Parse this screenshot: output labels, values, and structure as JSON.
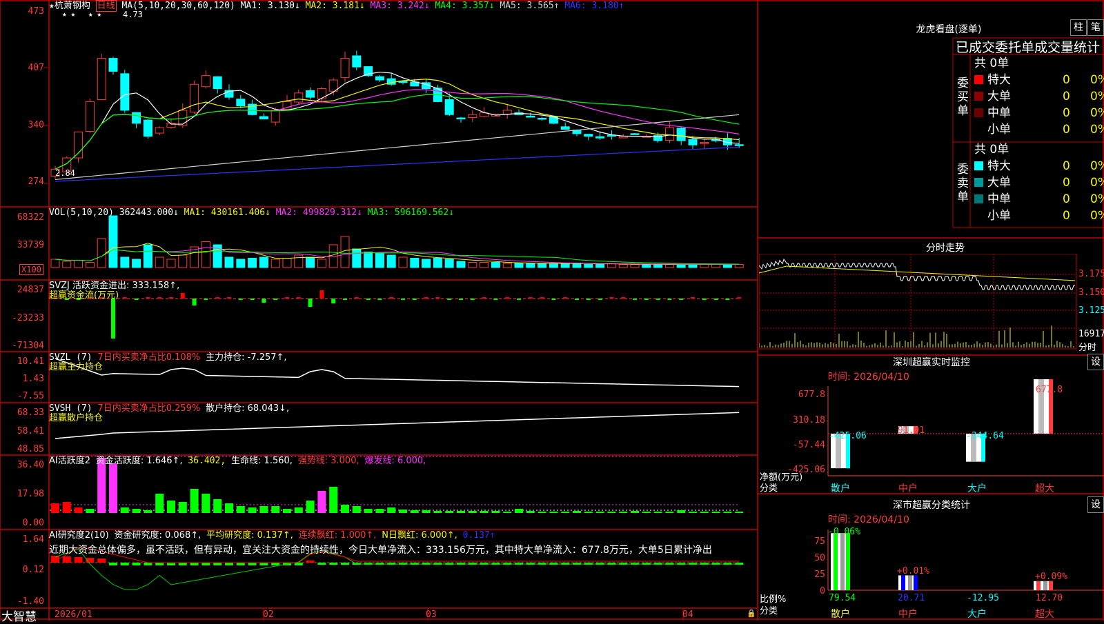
{
  "stock_name": "杭萧钢构",
  "period": "日线",
  "brand": "大智慧",
  "colors": {
    "up": "#ff3b3b",
    "down": "#00ffff",
    "grid": "#c00000",
    "ma1": "#ffffff",
    "ma2": "#f5f500",
    "ma3": "#ff33ff",
    "ma4": "#00ff00",
    "ma5": "#d0d0d0",
    "ma6": "#3030ff"
  },
  "main": {
    "ma_prefix": "MA(5,10,20,30,60,120)",
    "ma1": "MA1: 3.130↓",
    "ma2": "MA2: 3.181↓",
    "ma3": "MA3: 3.242↓",
    "ma4": "MA4: 3.357↓",
    "ma5": "MA5: 3.565↑",
    "ma6": "MA6: 3.180↑",
    "high_label": "4.73",
    "low_label": "2.84",
    "y_labels": [
      "473",
      "407",
      "340",
      "274"
    ]
  },
  "vol": {
    "title": "VOL(5,10,20)",
    "v": "362443.000↓",
    "ma1": "MA1: 430161.406↓",
    "ma2": "MA2: 499829.312↓",
    "ma3": "MA3: 596169.562↓",
    "y_labels": [
      "68322",
      "33739"
    ],
    "unit": "X100"
  },
  "svzj": {
    "title": "SVZJ  活跃资金进出: 333.158↑,",
    "sub": "超赢资金流(万元)",
    "y_labels": [
      "24837",
      "-23233",
      "-71304"
    ]
  },
  "svzl": {
    "title": "SVZL (7)",
    "t1": "7日内买卖净占比0.108%",
    "t2": "主力持仓: -7.257↑,",
    "sub": "超赢主力持仓",
    "y_labels": [
      "10.41",
      "1.43",
      "-7.55"
    ]
  },
  "svsh": {
    "title": "SVSH (7)",
    "t1": "7日内买卖净占比0.259%",
    "t2": "散户持仓: 68.043↓,",
    "sub": "超赢散户持仓",
    "y_labels": [
      "68.33",
      "58.41",
      "48.85"
    ]
  },
  "ai1": {
    "title": "AI活跃度2",
    "t1": "资金活跃度: 1.646↑,",
    "t2": "36.402,",
    "t3": "生命线: 1.560,",
    "t4": "强势线: 3.000,",
    "t5": "爆发线: 6.000,",
    "y_labels": [
      "36.40",
      "17.98",
      "0.00"
    ]
  },
  "ai2": {
    "title": "AI研究度2(10)",
    "t1": "资金研究度: 0.068↑,",
    "t2": "平均研究度: 0.137↑,",
    "t3": "连续飘红: 1.000↑,",
    "t4": "N日飘红: 6.000↑,",
    "t5": "0.137↑",
    "commentary": "近期大资金总体偏多，虽不活跃，但有异动，宜关注大资金的持续性，今日大单净流入：333.156万元，其中特大单净流入：677.8万元，大单5日累计净出",
    "y_labels": [
      "1.64",
      "0.12",
      "-1.40"
    ]
  },
  "x_labels": [
    "2026/01",
    "02",
    "03",
    "04"
  ],
  "dragon": {
    "title": "龙虎看盘(逐单)",
    "btn1": "柱",
    "btn2": "笔",
    "header": "已成交委托单成交量统计",
    "buy_label": "委买单",
    "sell_label": "委卖单",
    "buy_total": "共 0单",
    "sell_total": "共 0单",
    "buy_rows": [
      {
        "name": "特大",
        "count": "0",
        "pct": "0%",
        "color": "#ff0000"
      },
      {
        "name": "大单",
        "count": "0",
        "pct": "0%",
        "color": "#8b0000"
      },
      {
        "name": "中单",
        "count": "0",
        "pct": "0%",
        "color": "#6a0000"
      },
      {
        "name": "小单",
        "count": "0",
        "pct": "0%",
        "color": "#000000"
      }
    ],
    "sell_rows": [
      {
        "name": "特大",
        "count": "0",
        "pct": "0%",
        "color": "#00ffff"
      },
      {
        "name": "大单",
        "count": "0",
        "pct": "0%",
        "color": "#009999"
      },
      {
        "name": "中单",
        "count": "0",
        "pct": "0%",
        "color": "#007777"
      },
      {
        "name": "小单",
        "count": "0",
        "pct": "0%",
        "color": "#000000"
      }
    ]
  },
  "intraday": {
    "title": "分时走势",
    "y_labels": [
      "3.175",
      "3.150",
      "3.125"
    ],
    "vol_label": "16917",
    "vol_unit": "分时"
  },
  "monitor": {
    "title": "深圳超赢实时监控",
    "btn": "设",
    "time": "时间: 2026/04/10",
    "y_labels": [
      "677.8",
      "310.18",
      "-57.44",
      "-425.06"
    ],
    "axis_title1": "净额(万元)",
    "axis_title2": "分类",
    "categories": [
      "散户",
      "中户",
      "大户",
      "超大"
    ],
    "values": [
      -425.06,
      91.91,
      -344.64,
      677.8
    ],
    "value_labels": [
      "-425.06",
      "91.91",
      "-344.64",
      "677.8"
    ]
  },
  "classify": {
    "title": "深市超赢分类统计",
    "btn": "设",
    "time": "时间: 2026/04/10",
    "y_labels": [
      "75",
      "50",
      "25",
      "0"
    ],
    "axis_title1": "比例%",
    "axis_title2": "分类",
    "categories": [
      "散户",
      "中户",
      "大户",
      "超大"
    ],
    "top_labels": [
      "-0.06%",
      "+0.01%",
      "",
      "+0.09%"
    ],
    "bottom_labels": [
      "79.54",
      "20.71",
      "-12.95",
      "12.70"
    ],
    "values": [
      79.54,
      20.71,
      0,
      12.7
    ]
  }
}
